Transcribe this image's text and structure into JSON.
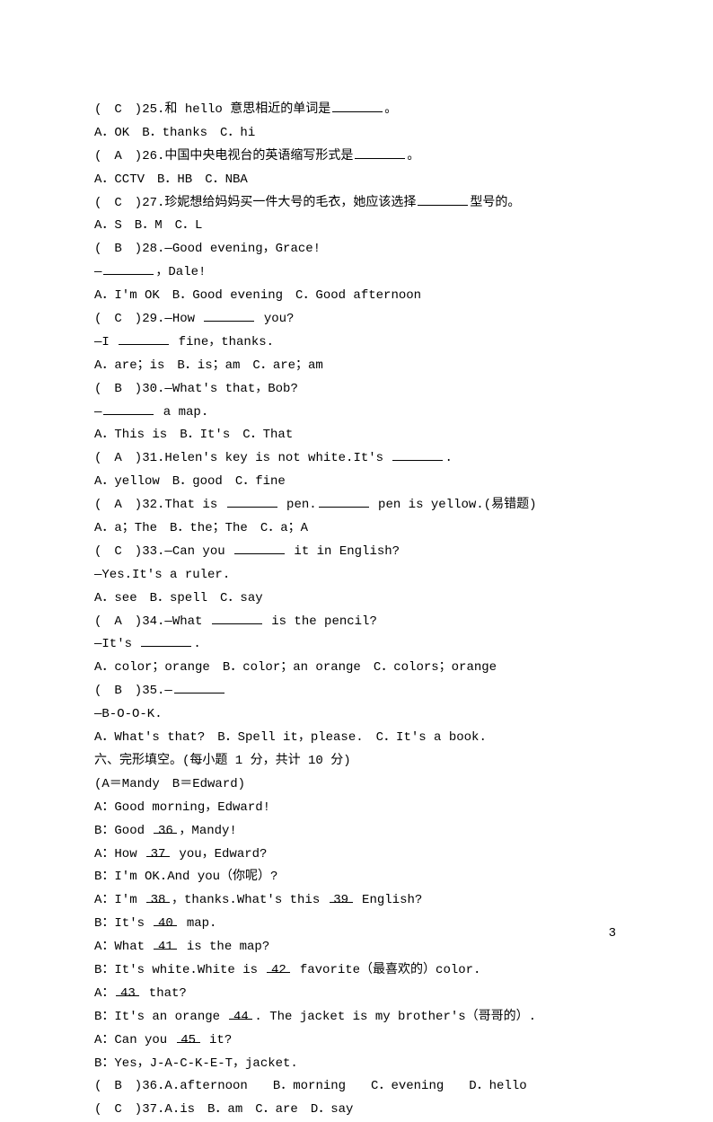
{
  "q25": {
    "stem_pre": "(　",
    "ans": "C",
    "stem_post": "　)25.和 hello 意思相近的单词是",
    "stem_tail": "。",
    "opts": "A．OK　B．thanks　C．hi"
  },
  "q26": {
    "stem_pre": "(　",
    "ans": "A",
    "stem_post": "　)26.中国中央电视台的英语缩写形式是",
    "stem_tail": "。",
    "opts": "A．CCTV　B．HB　C．NBA"
  },
  "q27": {
    "stem_pre": "(　",
    "ans": "C",
    "stem_post": "　)27.珍妮想给妈妈买一件大号的毛衣，她应该选择",
    "stem_tail": "型号的。",
    "opts": "A．S　B．M　C．L"
  },
  "q28": {
    "stem_pre": "(　",
    "ans": "B",
    "stem_post": "　)28.—Good evening，Grace!",
    "line2a": "—",
    "line2b": "，Dale!",
    "opts": "A．I'm OK　B．Good evening　C．Good afternoon"
  },
  "q29": {
    "stem_pre": "(　",
    "ans": "C",
    "stem_post": "　)29.—How ",
    "stem_tail": " you?",
    "line2a": "—I ",
    "line2b": " fine，thanks.",
    "opts": "A．are；is　B．is；am　C．are；am"
  },
  "q30": {
    "stem_pre": "(　",
    "ans": "B",
    "stem_post": "　)30.—What's that，Bob?",
    "line2a": "—",
    "line2b": " a map.",
    "opts": "A．This is　B．It's　C．That"
  },
  "q31": {
    "stem_pre": "(　",
    "ans": "A",
    "stem_post": "　)31.Helen's key is not white.It's ",
    "stem_tail": ".",
    "opts": "A．yellow　B．good　C．fine"
  },
  "q32": {
    "stem_pre": "(　",
    "ans": "A",
    "stem_post": "　)32.That is ",
    "mid": " pen.",
    "tail": " pen is yellow.(易错题)",
    "opts": "A．a；The　B．the；The　C．a；A"
  },
  "q33": {
    "stem_pre": "(　",
    "ans": "C",
    "stem_post": "　)33.—Can you ",
    "stem_tail": " it in English?",
    "line2": "—Yes.It's a ruler.",
    "opts": "A．see　B．spell　C．say"
  },
  "q34": {
    "stem_pre": "(　",
    "ans": "A",
    "stem_post": "　)34.—What ",
    "stem_tail": " is the pencil?",
    "line2a": "—It's ",
    "line2b": ".",
    "opts": "A．color；orange　B．color；an orange　C．colors；orange"
  },
  "q35": {
    "stem_pre": "(　",
    "ans": "B",
    "stem_post": "　)35.—",
    "line2": "—B-O-O-K.",
    "opts": "A．What's that?　B．Spell it，please.　C．It's a book."
  },
  "section6": "六、完形填空。(每小题 1 分，共计 10 分)",
  "cloze_note": "(A＝Mandy　B＝Edward)",
  "c1": "A：Good morning，Edward!",
  "c2a": "B：Good ",
  "c2n": "36",
  "c2b": "，Mandy!",
  "c3a": "A：How ",
  "c3n": "37",
  "c3b": " you，Edward?",
  "c4": "B：I'm OK.And you（你呢）?",
  "c5a": "A：I'm ",
  "c5n": "38",
  "c5b": "，thanks.What's this ",
  "c5n2": "39",
  "c5c": " English?",
  "c6a": "B：It's ",
  "c6n": "40",
  "c6b": " map.",
  "c7a": "A：What ",
  "c7n": "41",
  "c7b": " is the map?",
  "c8a": "B：It's white.White is ",
  "c8n": "42",
  "c8b": " favorite（最喜欢的）color.",
  "c9a": "A：",
  "c9n": "43",
  "c9b": " that?",
  "c10a": "B：It's an orange ",
  "c10n": "44",
  "c10b": ". The jacket is my brother's（哥哥的）.",
  "c11a": "A：Can you ",
  "c11n": "45",
  "c11b": " it?",
  "c12": "B：Yes，J-A-C-K-E-T，jacket.",
  "a36": {
    "pre": "(　",
    "ans": "B",
    "post": "　)36.A.afternoon　　B．morning　　C．evening　　D．hello"
  },
  "a37": {
    "pre": "(　",
    "ans": "C",
    "post": "　)37.A.is　B．am　C．are　D．say"
  },
  "page": "3"
}
